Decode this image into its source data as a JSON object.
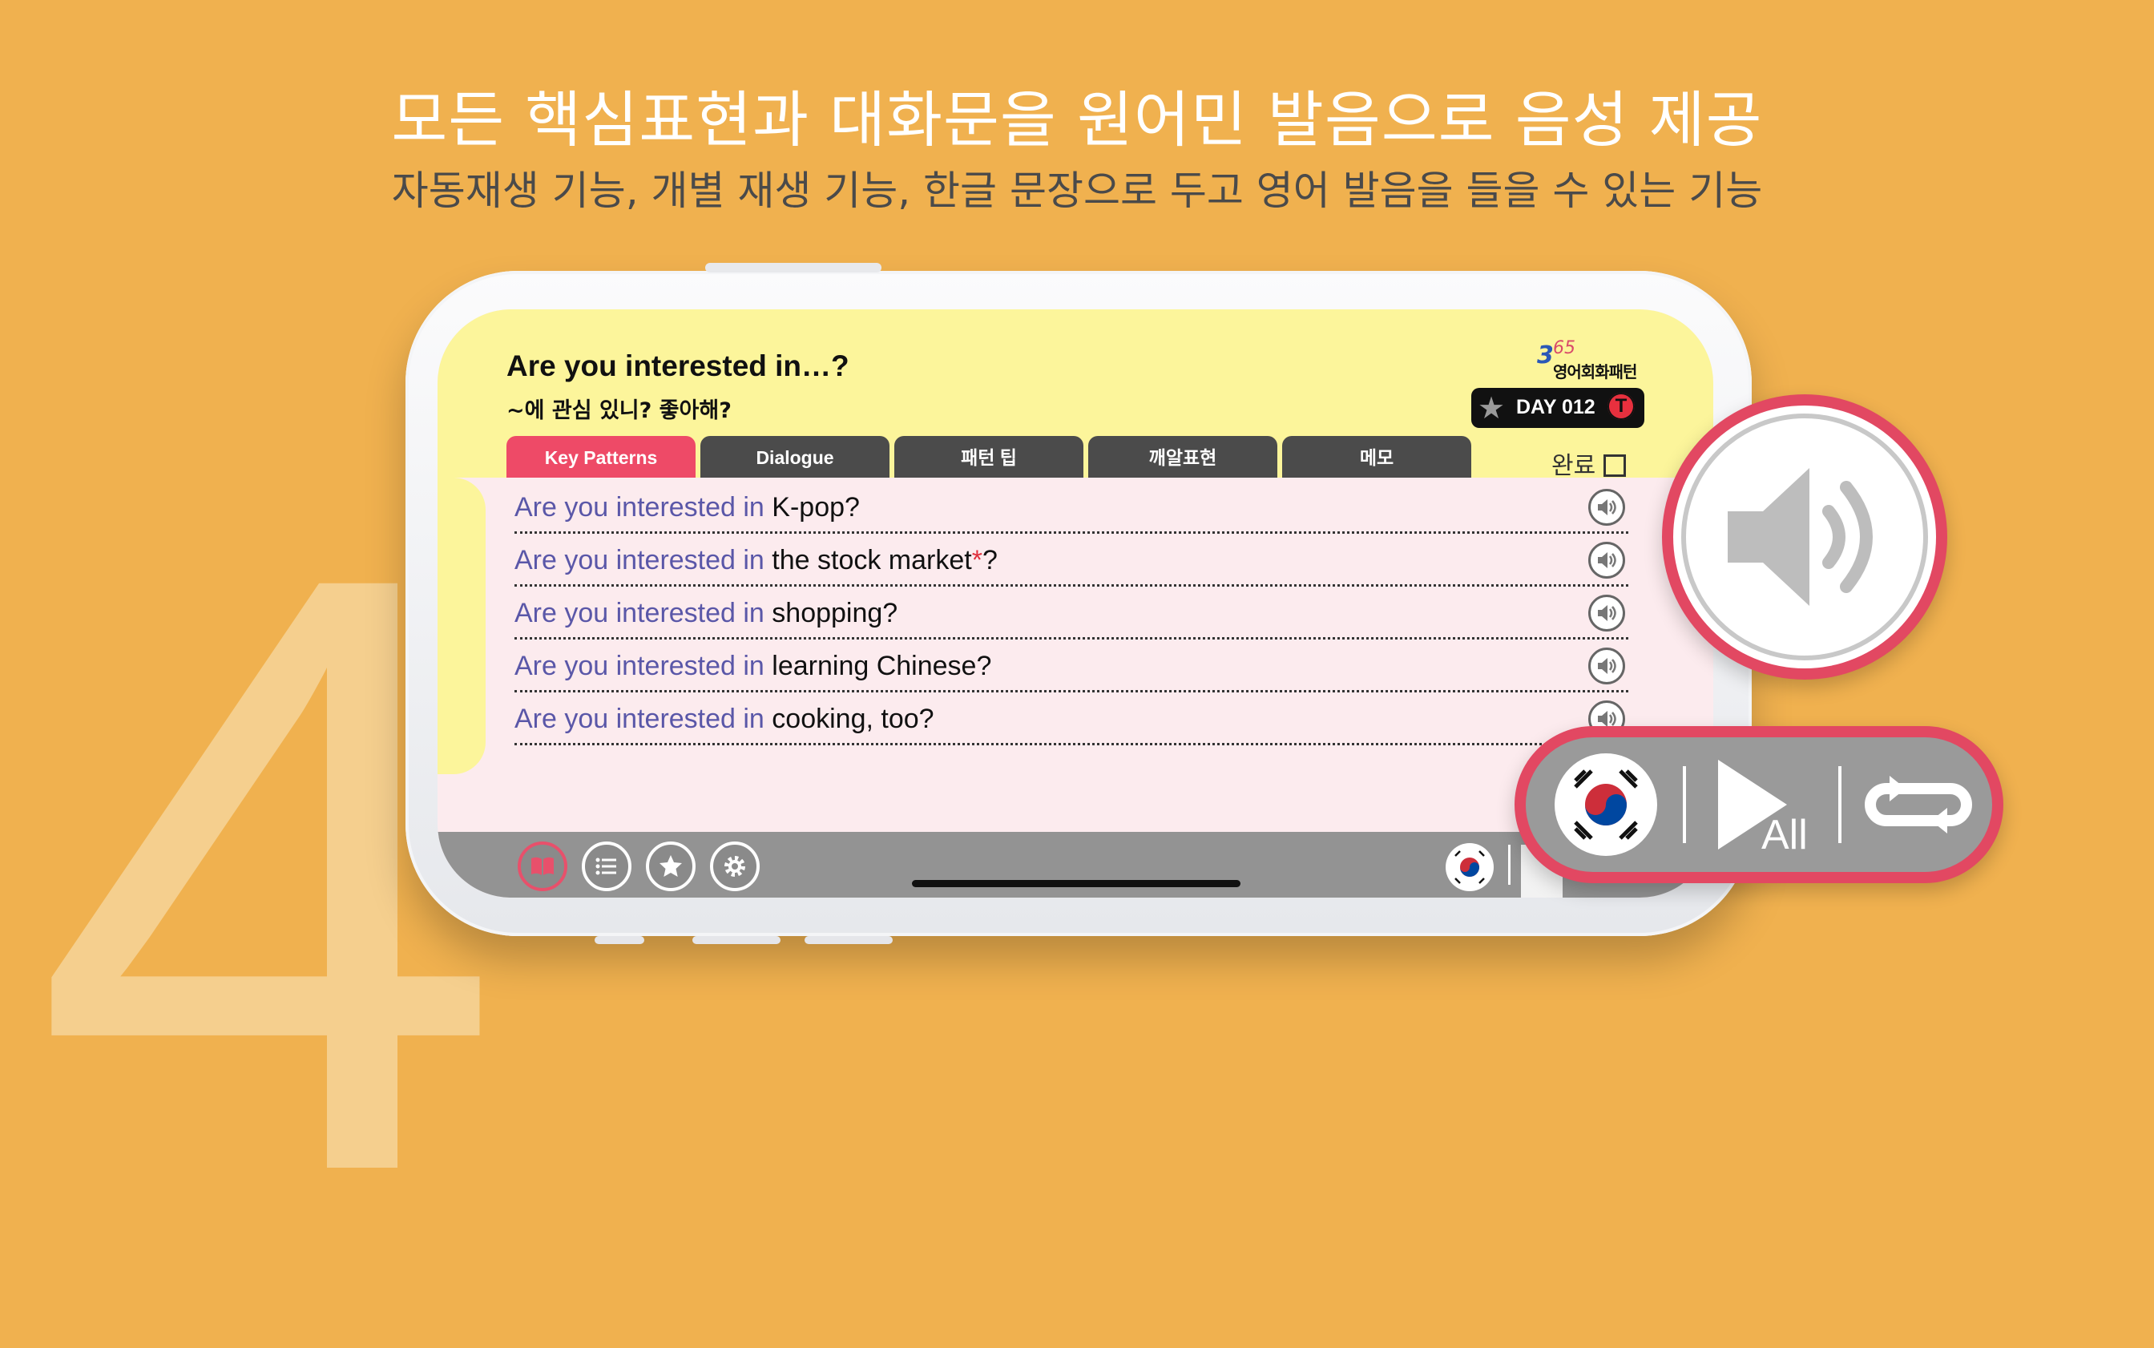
{
  "background": {
    "number": "4",
    "color": "#F0B14F"
  },
  "banner": {
    "headline": "모든 핵심표현과 대화문을 원어민 발음으로 음성 제공",
    "subline": "자동재생 기능, 개별 재생 기능, 한글 문장으로 두고 영어 발음을 들을 수 있는 기능"
  },
  "app": {
    "title_en": "Are you interested in…?",
    "title_ko": "~에 관심 있니? 좋아해?",
    "logo": {
      "num": "3",
      "num_small": "65",
      "text": "영어회화패턴"
    },
    "day_badge": {
      "label": "DAY 012",
      "t": "T"
    },
    "tabs": [
      "Key Patterns",
      "Dialogue",
      "패턴 팁",
      "깨알표현",
      "메모"
    ],
    "active_tab": "Key Patterns",
    "done_label": "완료",
    "rows": [
      {
        "pattern": "Are you interested in",
        "rest": " K-pop?",
        "asterisk": "",
        "tail": ""
      },
      {
        "pattern": "Are you interested in",
        "rest": " the stock market",
        "asterisk": "*",
        "tail": "?"
      },
      {
        "pattern": "Are you interested in",
        "rest": " shopping?",
        "asterisk": "",
        "tail": ""
      },
      {
        "pattern": "Are you interested in",
        "rest": " learning Chinese?",
        "asterisk": "",
        "tail": ""
      },
      {
        "pattern": "Are you interested in",
        "rest": " cooking, too?",
        "asterisk": "",
        "tail": ""
      }
    ],
    "bottom_icons": [
      "book-icon",
      "list-icon",
      "star-icon",
      "gear-icon"
    ]
  },
  "overlay": {
    "play_all_label": "All"
  },
  "colors": {
    "accent": "#EE4A67",
    "pattern_text": "#5a57a8",
    "header_bg": "#FCF59B",
    "content_bg": "#FCEBEE"
  }
}
